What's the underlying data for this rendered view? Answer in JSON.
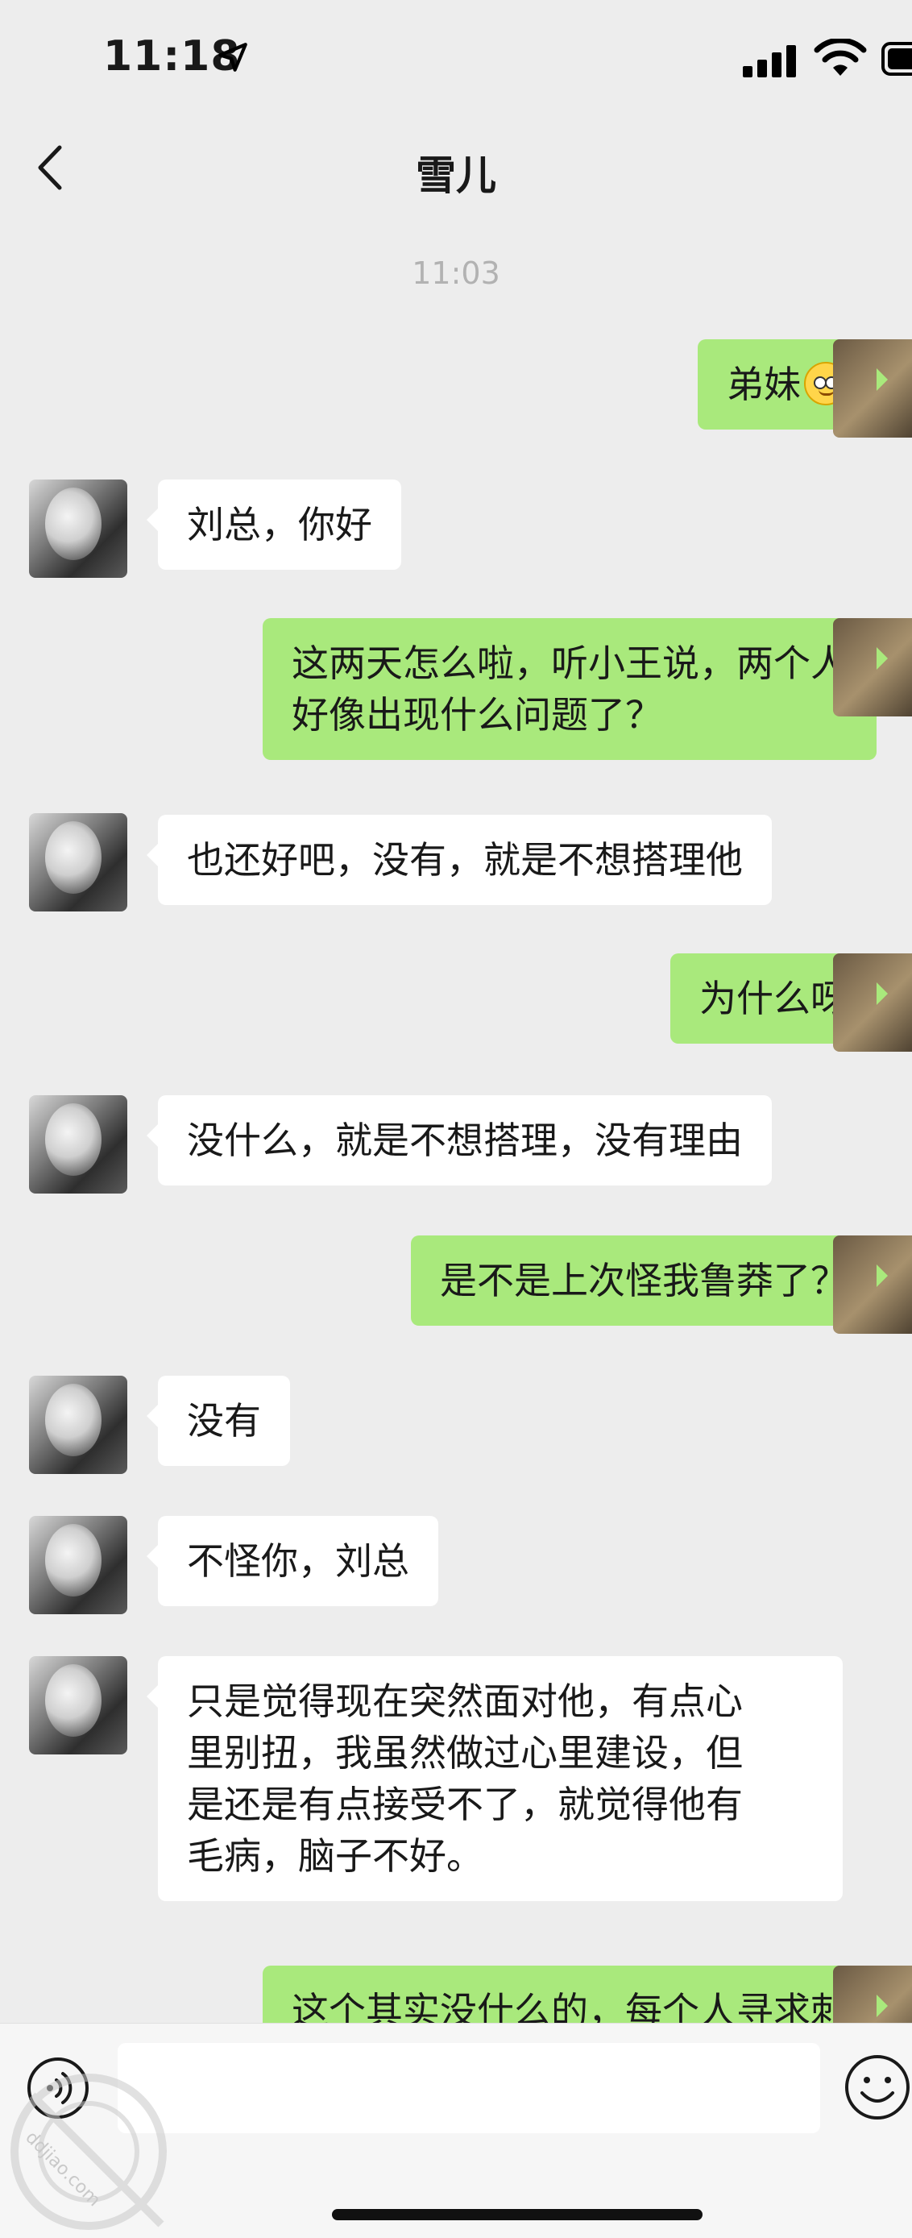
{
  "status_bar": {
    "time": "11:18",
    "icons": [
      "location-arrow-icon",
      "cellular-signal-icon",
      "wifi-icon",
      "battery-icon"
    ]
  },
  "nav": {
    "title": "雪儿",
    "back_icon": "chevron-left-icon"
  },
  "chat": {
    "timestamp": "11:03",
    "messages": [
      {
        "from": "self",
        "lines": [
          "弟妹"
        ],
        "emoji": "smiling-face-icon"
      },
      {
        "from": "other",
        "lines": [
          "刘总，你好"
        ]
      },
      {
        "from": "self",
        "lines": [
          "这两天怎么啦，听小王说，两个人",
          "好像出现什么问题了？"
        ]
      },
      {
        "from": "other",
        "lines": [
          "也还好吧，没有，就是不想搭理他"
        ]
      },
      {
        "from": "self",
        "lines": [
          "为什么呀"
        ]
      },
      {
        "from": "other",
        "lines": [
          "没什么，就是不想搭理，没有理由"
        ]
      },
      {
        "from": "self",
        "lines": [
          "是不是上次怪我鲁莽了？"
        ]
      },
      {
        "from": "other",
        "lines": [
          "没有"
        ]
      },
      {
        "from": "other",
        "lines": [
          "不怪你，刘总"
        ]
      },
      {
        "from": "other",
        "lines": [
          "只是觉得现在突然面对他，有点心",
          "里别扭，我虽然做过心里建设，但",
          "是还是有点接受不了，就觉得他有",
          "毛病，脑子不好。"
        ]
      },
      {
        "from": "self",
        "lines": [
          "这个其实没什么的，每个人寻求刺"
        ]
      }
    ]
  },
  "input_bar": {
    "voice_icon": "voice-icon",
    "emoji_icon": "emoji-face-icon",
    "input_value": ""
  },
  "watermark": {
    "text": "ddjiao.com"
  },
  "colors": {
    "background": "#ededed",
    "bubble_self": "#a9e97c",
    "bubble_other": "#ffffff",
    "timestamp": "#b2b2b2"
  }
}
